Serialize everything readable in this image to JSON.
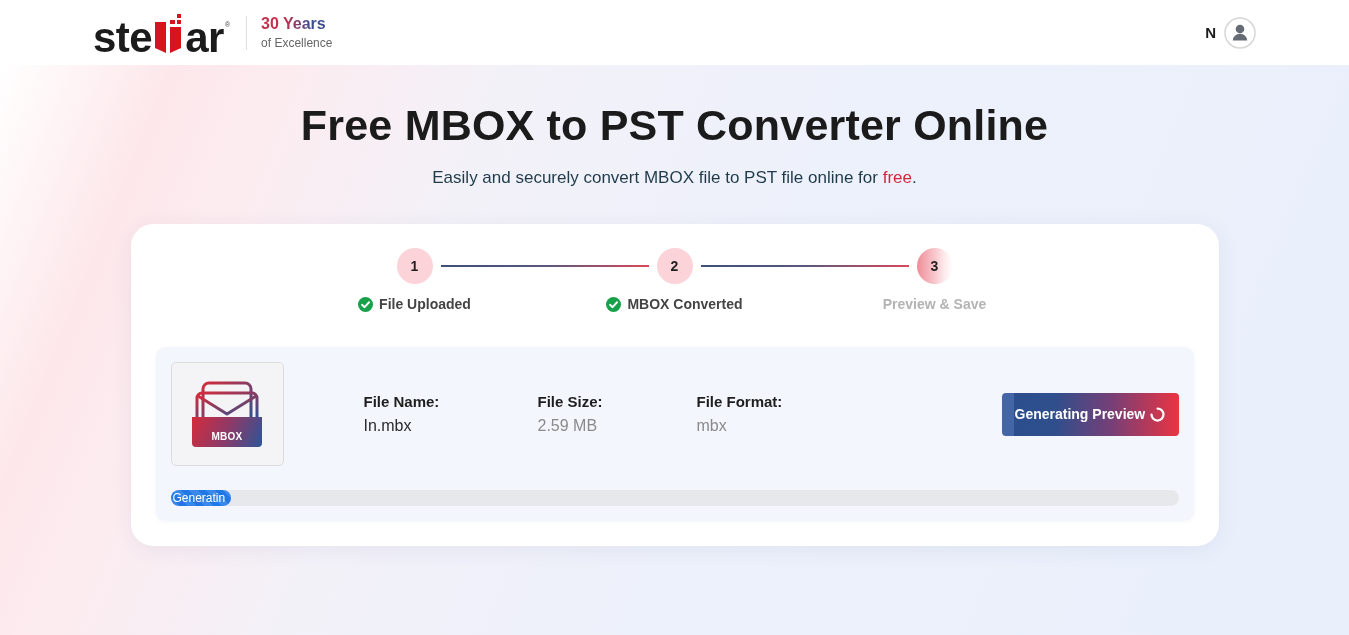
{
  "header": {
    "logo": {
      "start": "ste",
      "end": "ar",
      "mark": "®"
    },
    "tagline": {
      "title": "30 Years",
      "subtitle": "of Excellence"
    },
    "user": {
      "initial": "N"
    }
  },
  "hero": {
    "title": "Free MBOX to PST Converter Online",
    "subtitle": {
      "before": "Easily and securely convert MBOX file to PST file online for ",
      "highlight": "free",
      "after": "."
    }
  },
  "steps": [
    {
      "number": "1",
      "label": "File Uploaded",
      "completed": true
    },
    {
      "number": "2",
      "label": "MBOX Converted",
      "completed": true
    },
    {
      "number": "3",
      "label": "Preview & Save",
      "completed": false
    }
  ],
  "file": {
    "type_label": "MBOX",
    "details": [
      {
        "label": "File Name:",
        "value": "In.mbx",
        "muted": false
      },
      {
        "label": "File Size:",
        "value": "2.59 MB",
        "muted": true
      },
      {
        "label": "File Format:",
        "value": "mbx",
        "muted": true
      }
    ]
  },
  "action_button": {
    "label": "Generating Preview",
    "loading": true
  },
  "progress": {
    "label": "Generatin",
    "level": 0.06
  }
}
